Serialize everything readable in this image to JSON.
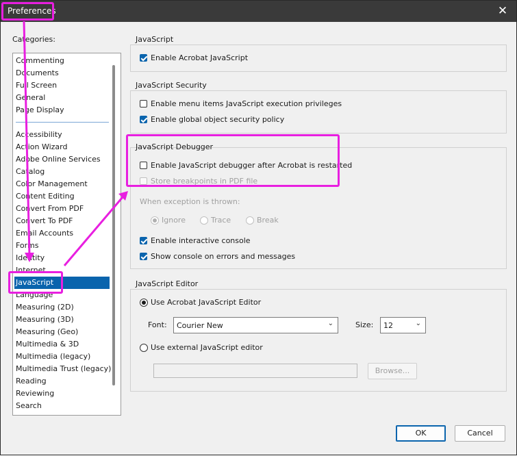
{
  "window": {
    "title": "Preferences",
    "close_glyph": "✕"
  },
  "categories": {
    "label": "Categories:",
    "top_items": [
      "Commenting",
      "Documents",
      "Full Screen",
      "General",
      "Page Display"
    ],
    "items": [
      "Accessibility",
      "Action Wizard",
      "Adobe Online Services",
      "Catalog",
      "Color Management",
      "Content Editing",
      "Convert From PDF",
      "Convert To PDF",
      "Email Accounts",
      "Forms",
      "Identity",
      "Internet",
      "JavaScript",
      "Language",
      "Measuring (2D)",
      "Measuring (3D)",
      "Measuring (Geo)",
      "Multimedia & 3D",
      "Multimedia (legacy)",
      "Multimedia Trust (legacy)",
      "Reading",
      "Reviewing",
      "Search"
    ],
    "selected": "JavaScript"
  },
  "javascript": {
    "title": "JavaScript",
    "enable_acrobat_js": {
      "label": "Enable Acrobat JavaScript",
      "checked": true
    }
  },
  "security": {
    "title": "JavaScript Security",
    "menu_items": {
      "label": "Enable menu items JavaScript execution privileges",
      "checked": false
    },
    "global_object": {
      "label": "Enable global object security policy",
      "checked": true
    }
  },
  "debugger": {
    "title": "JavaScript Debugger",
    "enable_debugger": {
      "label": "Enable JavaScript debugger after Acrobat is restarted",
      "checked": false
    },
    "store_breakpoints": {
      "label": "Store breakpoints in PDF file",
      "checked": false,
      "disabled": true
    },
    "exception_label": "When exception is thrown:",
    "exception_options": [
      "Ignore",
      "Trace",
      "Break"
    ],
    "exception_selected": "Ignore",
    "interactive_console": {
      "label": "Enable interactive console",
      "checked": true
    },
    "show_console": {
      "label": "Show console on errors and messages",
      "checked": true
    }
  },
  "editor": {
    "title": "JavaScript Editor",
    "use_acrobat": "Use Acrobat JavaScript Editor",
    "use_external": "Use external JavaScript editor",
    "selected": "acrobat",
    "font_label": "Font:",
    "font_value": "Courier New",
    "size_label": "Size:",
    "size_value": "12",
    "browse_label": "Browse..."
  },
  "buttons": {
    "ok": "OK",
    "cancel": "Cancel"
  },
  "colors": {
    "accent": "#0a64ad",
    "highlight": "#e81fe0",
    "titlebar": "#3a3a3a"
  }
}
